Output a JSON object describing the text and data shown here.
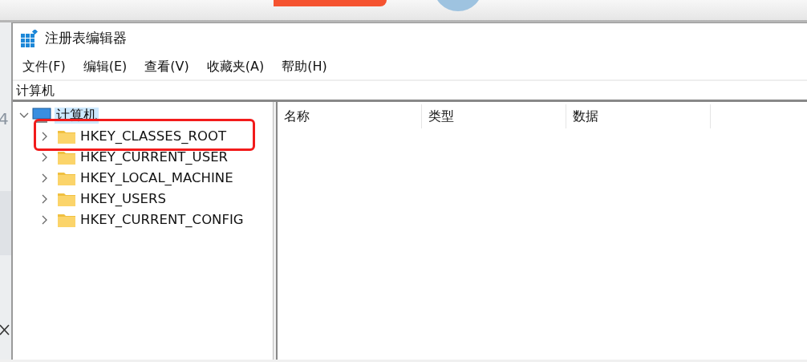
{
  "background": {
    "edge_text": "4"
  },
  "window": {
    "title": "注册表编辑器"
  },
  "menu": [
    "文件(F)",
    "编辑(E)",
    "查看(V)",
    "收藏夹(A)",
    "帮助(H)"
  ],
  "address": "计算机",
  "tree": [
    {
      "label": "计算机",
      "kind": "computer",
      "expanded": true,
      "selected": true,
      "children": [
        {
          "label": "HKEY_CLASSES_ROOT",
          "kind": "folder",
          "expanded": false,
          "selected": false
        },
        {
          "label": "HKEY_CURRENT_USER",
          "kind": "folder",
          "expanded": false,
          "selected": false
        },
        {
          "label": "HKEY_LOCAL_MACHINE",
          "kind": "folder",
          "expanded": false,
          "selected": false
        },
        {
          "label": "HKEY_USERS",
          "kind": "folder",
          "expanded": false,
          "selected": false
        },
        {
          "label": "HKEY_CURRENT_CONFIG",
          "kind": "folder",
          "expanded": false,
          "selected": false
        }
      ]
    }
  ],
  "list": {
    "columns": [
      "名称",
      "类型",
      "数据"
    ]
  }
}
